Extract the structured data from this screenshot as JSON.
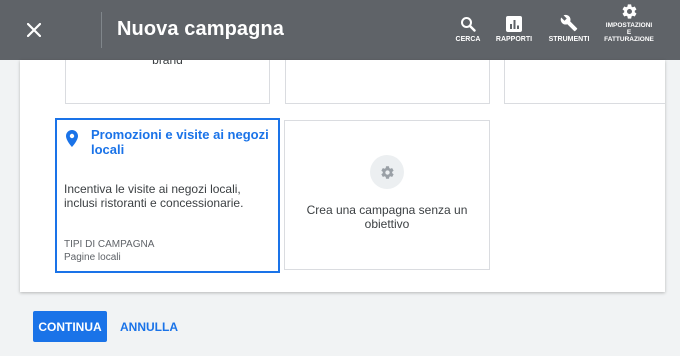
{
  "header": {
    "title": "Nuova campagna",
    "tools": {
      "search": "CERCA",
      "reports": "RAPPORTI",
      "tools": "STRUMENTI",
      "settings": [
        "IMPOSTAZIONI",
        "E",
        "FATTURAZIONE"
      ]
    }
  },
  "cards": {
    "top1_text": "brand",
    "local": {
      "title": "Promozioni e visite ai negozi locali",
      "description": "Incentiva le visite ai negozi locali, inclusi ristoranti e concessionarie.",
      "types_label": "TIPI DI CAMPAGNA",
      "types_value": "Pagine locali"
    },
    "no_objective": {
      "text": "Crea una campagna senza un obiettivo"
    }
  },
  "footer": {
    "continue_label": "CONTINUA",
    "cancel_label": "ANNULLA"
  },
  "colors": {
    "accent": "#1a73e8",
    "header_bg": "#5f6368"
  }
}
